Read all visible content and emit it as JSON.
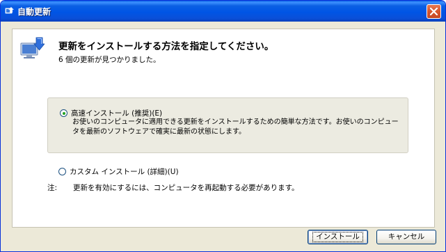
{
  "window": {
    "title": "自動更新",
    "close_icon": "close-icon"
  },
  "header": {
    "heading": "更新をインストールする方法を指定してください。",
    "subheading": "6 個の更新が見つかりました。"
  },
  "options": {
    "express": {
      "label": "高速インストール (推奨)(E)",
      "description": "お使いのコンピュータに適用できる更新をインストールするための簡単な方法です。お使いのコンピュータを最新のソフトウェアで確実に最新の状態にします。",
      "selected": true
    },
    "custom": {
      "label": "カスタム インストール (詳細)(U)",
      "selected": false
    }
  },
  "note": {
    "prefix": "注:",
    "text": "更新を有効にするには、コンピュータを再起動する必要があります。"
  },
  "buttons": {
    "install": "インストール",
    "cancel": "キャンセル"
  },
  "colors": {
    "titlebar": "#0055e5",
    "dialog_bg": "#ece9d8",
    "radio_dot": "#21a121"
  }
}
